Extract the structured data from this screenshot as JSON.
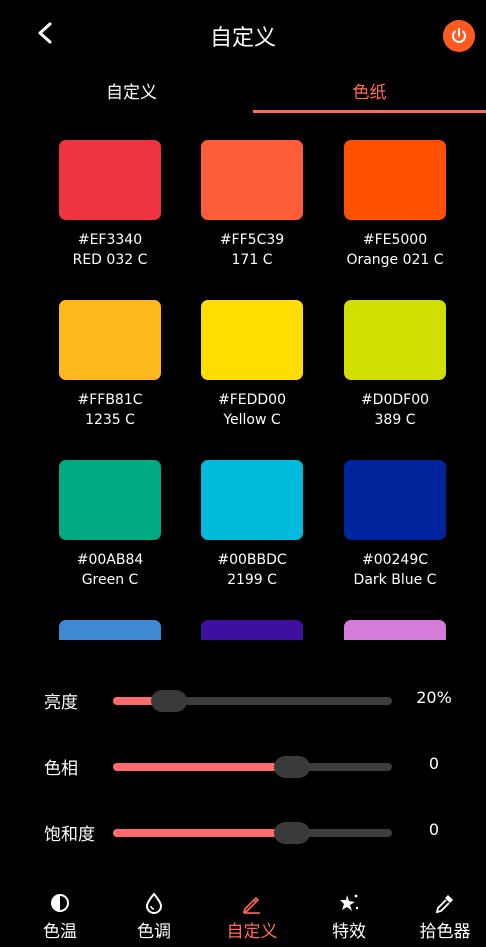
{
  "header": {
    "title": "自定义",
    "back_icon": "chevron-left-icon",
    "power_icon": "power-icon",
    "accent": "#ff5a1f"
  },
  "tabs": [
    {
      "label": "自定义",
      "active": false
    },
    {
      "label": "色纸",
      "active": true
    }
  ],
  "swatches": [
    {
      "color": "#EF3340",
      "hex": "#EF3340",
      "code": "RED 032 C"
    },
    {
      "color": "#FF5C39",
      "hex": "#FF5C39",
      "code": "171 C"
    },
    {
      "color": "#FE5000",
      "hex": "#FE5000",
      "code": "Orange 021 C"
    },
    {
      "color": "#FFB81C",
      "hex": "#FFB81C",
      "code": "1235 C"
    },
    {
      "color": "#FEDD00",
      "hex": "#FEDD00",
      "code": "Yellow C"
    },
    {
      "color": "#D0DF00",
      "hex": "#D0DF00",
      "code": "389 C"
    },
    {
      "color": "#00AB84",
      "hex": "#00AB84",
      "code": "Green C"
    },
    {
      "color": "#00BBDC",
      "hex": "#00BBDC",
      "code": "2199 C"
    },
    {
      "color": "#00249C",
      "hex": "#00249C",
      "code": "Dark Blue C"
    },
    {
      "color": "#3F88D2",
      "hex": "",
      "code": ""
    },
    {
      "color": "#3F0FA0",
      "hex": "",
      "code": ""
    },
    {
      "color": "#D57BD9",
      "hex": "",
      "code": ""
    }
  ],
  "sliders": [
    {
      "label": "亮度",
      "value": "20%",
      "level": 0.2
    },
    {
      "label": "色相",
      "value": "0",
      "level": 0.64
    },
    {
      "label": "饱和度",
      "value": "0",
      "level": 0.64
    }
  ],
  "bottom_nav": [
    {
      "label": "色温",
      "icon": "half-circle-icon",
      "active": false
    },
    {
      "label": "色调",
      "icon": "drop-icon",
      "active": false
    },
    {
      "label": "自定义",
      "icon": "pencil-icon",
      "active": true
    },
    {
      "label": "特效",
      "icon": "sparkle-icon",
      "active": false
    },
    {
      "label": "拾色器",
      "icon": "eyedropper-icon",
      "active": false
    }
  ]
}
